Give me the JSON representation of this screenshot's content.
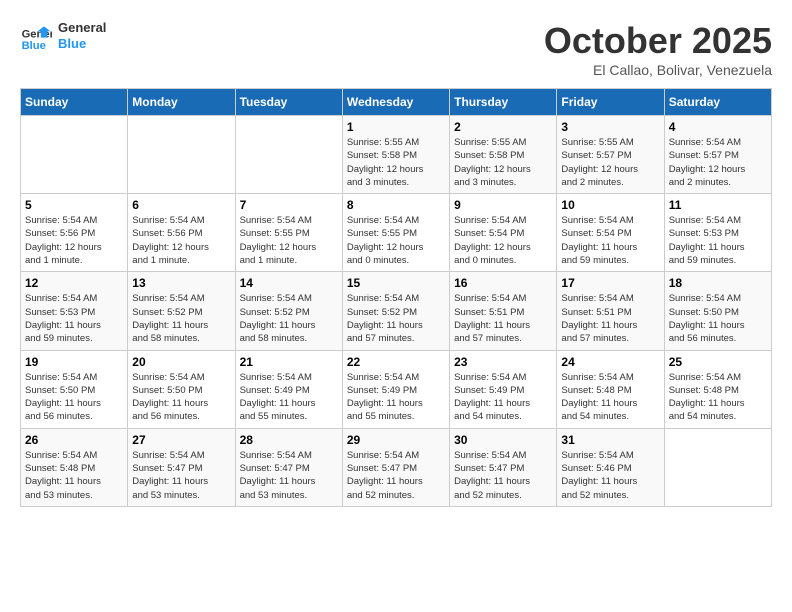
{
  "header": {
    "logo_line1": "General",
    "logo_line2": "Blue",
    "month": "October 2025",
    "location": "El Callao, Bolivar, Venezuela"
  },
  "weekdays": [
    "Sunday",
    "Monday",
    "Tuesday",
    "Wednesday",
    "Thursday",
    "Friday",
    "Saturday"
  ],
  "weeks": [
    [
      {
        "day": "",
        "info": ""
      },
      {
        "day": "",
        "info": ""
      },
      {
        "day": "",
        "info": ""
      },
      {
        "day": "1",
        "info": "Sunrise: 5:55 AM\nSunset: 5:58 PM\nDaylight: 12 hours\nand 3 minutes."
      },
      {
        "day": "2",
        "info": "Sunrise: 5:55 AM\nSunset: 5:58 PM\nDaylight: 12 hours\nand 3 minutes."
      },
      {
        "day": "3",
        "info": "Sunrise: 5:55 AM\nSunset: 5:57 PM\nDaylight: 12 hours\nand 2 minutes."
      },
      {
        "day": "4",
        "info": "Sunrise: 5:54 AM\nSunset: 5:57 PM\nDaylight: 12 hours\nand 2 minutes."
      }
    ],
    [
      {
        "day": "5",
        "info": "Sunrise: 5:54 AM\nSunset: 5:56 PM\nDaylight: 12 hours\nand 1 minute."
      },
      {
        "day": "6",
        "info": "Sunrise: 5:54 AM\nSunset: 5:56 PM\nDaylight: 12 hours\nand 1 minute."
      },
      {
        "day": "7",
        "info": "Sunrise: 5:54 AM\nSunset: 5:55 PM\nDaylight: 12 hours\nand 1 minute."
      },
      {
        "day": "8",
        "info": "Sunrise: 5:54 AM\nSunset: 5:55 PM\nDaylight: 12 hours\nand 0 minutes."
      },
      {
        "day": "9",
        "info": "Sunrise: 5:54 AM\nSunset: 5:54 PM\nDaylight: 12 hours\nand 0 minutes."
      },
      {
        "day": "10",
        "info": "Sunrise: 5:54 AM\nSunset: 5:54 PM\nDaylight: 11 hours\nand 59 minutes."
      },
      {
        "day": "11",
        "info": "Sunrise: 5:54 AM\nSunset: 5:53 PM\nDaylight: 11 hours\nand 59 minutes."
      }
    ],
    [
      {
        "day": "12",
        "info": "Sunrise: 5:54 AM\nSunset: 5:53 PM\nDaylight: 11 hours\nand 59 minutes."
      },
      {
        "day": "13",
        "info": "Sunrise: 5:54 AM\nSunset: 5:52 PM\nDaylight: 11 hours\nand 58 minutes."
      },
      {
        "day": "14",
        "info": "Sunrise: 5:54 AM\nSunset: 5:52 PM\nDaylight: 11 hours\nand 58 minutes."
      },
      {
        "day": "15",
        "info": "Sunrise: 5:54 AM\nSunset: 5:52 PM\nDaylight: 11 hours\nand 57 minutes."
      },
      {
        "day": "16",
        "info": "Sunrise: 5:54 AM\nSunset: 5:51 PM\nDaylight: 11 hours\nand 57 minutes."
      },
      {
        "day": "17",
        "info": "Sunrise: 5:54 AM\nSunset: 5:51 PM\nDaylight: 11 hours\nand 57 minutes."
      },
      {
        "day": "18",
        "info": "Sunrise: 5:54 AM\nSunset: 5:50 PM\nDaylight: 11 hours\nand 56 minutes."
      }
    ],
    [
      {
        "day": "19",
        "info": "Sunrise: 5:54 AM\nSunset: 5:50 PM\nDaylight: 11 hours\nand 56 minutes."
      },
      {
        "day": "20",
        "info": "Sunrise: 5:54 AM\nSunset: 5:50 PM\nDaylight: 11 hours\nand 56 minutes."
      },
      {
        "day": "21",
        "info": "Sunrise: 5:54 AM\nSunset: 5:49 PM\nDaylight: 11 hours\nand 55 minutes."
      },
      {
        "day": "22",
        "info": "Sunrise: 5:54 AM\nSunset: 5:49 PM\nDaylight: 11 hours\nand 55 minutes."
      },
      {
        "day": "23",
        "info": "Sunrise: 5:54 AM\nSunset: 5:49 PM\nDaylight: 11 hours\nand 54 minutes."
      },
      {
        "day": "24",
        "info": "Sunrise: 5:54 AM\nSunset: 5:48 PM\nDaylight: 11 hours\nand 54 minutes."
      },
      {
        "day": "25",
        "info": "Sunrise: 5:54 AM\nSunset: 5:48 PM\nDaylight: 11 hours\nand 54 minutes."
      }
    ],
    [
      {
        "day": "26",
        "info": "Sunrise: 5:54 AM\nSunset: 5:48 PM\nDaylight: 11 hours\nand 53 minutes."
      },
      {
        "day": "27",
        "info": "Sunrise: 5:54 AM\nSunset: 5:47 PM\nDaylight: 11 hours\nand 53 minutes."
      },
      {
        "day": "28",
        "info": "Sunrise: 5:54 AM\nSunset: 5:47 PM\nDaylight: 11 hours\nand 53 minutes."
      },
      {
        "day": "29",
        "info": "Sunrise: 5:54 AM\nSunset: 5:47 PM\nDaylight: 11 hours\nand 52 minutes."
      },
      {
        "day": "30",
        "info": "Sunrise: 5:54 AM\nSunset: 5:47 PM\nDaylight: 11 hours\nand 52 minutes."
      },
      {
        "day": "31",
        "info": "Sunrise: 5:54 AM\nSunset: 5:46 PM\nDaylight: 11 hours\nand 52 minutes."
      },
      {
        "day": "",
        "info": ""
      }
    ]
  ]
}
